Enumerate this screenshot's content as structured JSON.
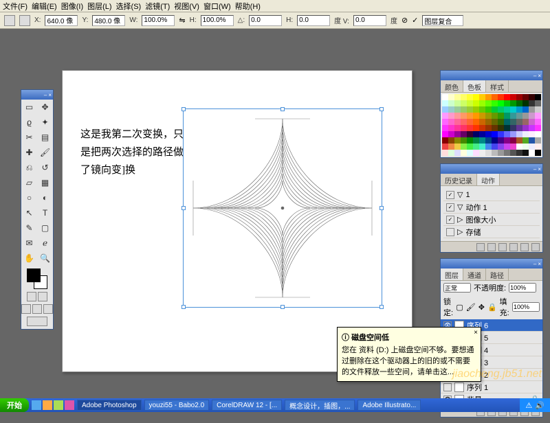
{
  "menu": [
    "文件(F)",
    "编辑(E)",
    "图像(I)",
    "图层(L)",
    "选择(S)",
    "滤镜(T)",
    "视图(V)",
    "窗口(W)",
    "帮助(H)"
  ],
  "optbar": {
    "x_label": "X:",
    "x": "640.0 像",
    "y_label": "Y:",
    "y": "480.0 像",
    "w_label": "W:",
    "w": "100.0%",
    "h_label": "H:",
    "h": "100.0%",
    "delta_label": "△:",
    "delta": "0.0",
    "hskew_label": "H:",
    "hskew": "0.0",
    "vskew_label": "度 V:",
    "vskew": "0.0",
    "deg": "度",
    "mode": "图层复合"
  },
  "doc_text": "这是我第二次变换，只是把两次选择的路径做了镜向变]换",
  "swatch_panel": {
    "tabs": [
      "颜色",
      "色板",
      "样式"
    ]
  },
  "history_panel": {
    "tabs": [
      "历史记录",
      "动作"
    ],
    "items": [
      {
        "chk": "✓",
        "expand": "▽",
        "icon": "■",
        "label": "1"
      },
      {
        "chk": "✓",
        "expand": "▽",
        "icon": "",
        "label": "动作 1"
      },
      {
        "chk": "✓",
        "expand": "▷",
        "icon": "",
        "label": "图像大小"
      },
      {
        "chk": "",
        "expand": "▷",
        "icon": "",
        "label": "存储"
      }
    ]
  },
  "layers_panel": {
    "tabs": [
      "图层",
      "通道",
      "路径"
    ],
    "mode_label": "正常",
    "opacity_label": "不透明度:",
    "opacity": "100%",
    "lock_label": "锁定:",
    "fill_label": "填充:",
    "fill": "100%",
    "layers": [
      {
        "eye": "👁",
        "name": "序列 6",
        "active": true
      },
      {
        "eye": "",
        "name": "序列 5"
      },
      {
        "eye": "",
        "name": "序列 4"
      },
      {
        "eye": "",
        "name": "序列 3"
      },
      {
        "eye": "",
        "name": "序列 2"
      },
      {
        "eye": "",
        "name": "序列 1"
      },
      {
        "eye": "👁",
        "name": "背景",
        "locked": true
      }
    ]
  },
  "balloon": {
    "title": "磁盘空间低",
    "body": "您在 资料 (D:) 上磁盘空间不够。要想通过删除在这个驱动器上的旧的或不需要的文件释放一些空间，请单击这...",
    "close": "×"
  },
  "watermark": "jiaocheng.jb51.net",
  "taskbar": {
    "start": "开始",
    "tasks": [
      "Adobe Photoshop",
      "youzi55 - Babo2.0",
      "CorelDRAW 12 - [...",
      "概念设计，插图，...",
      "Adobe Illustrato..."
    ]
  },
  "swatch_colors": [
    "#fff",
    "#ffc",
    "#ff9",
    "#ff6",
    "#ff3",
    "#ff0",
    "#fc0",
    "#f90",
    "#f60",
    "#f30",
    "#f00",
    "#c00",
    "#900",
    "#600",
    "#300",
    "#000",
    "#cff",
    "#cfc",
    "#cf9",
    "#cf6",
    "#cf3",
    "#cf0",
    "#9f0",
    "#6f0",
    "#3f0",
    "#0f0",
    "#0c0",
    "#090",
    "#060",
    "#030",
    "#333",
    "#666",
    "#9cf",
    "#9cc",
    "#9c9",
    "#9c6",
    "#9c3",
    "#9c0",
    "#6c0",
    "#3c0",
    "#0c3",
    "#0c6",
    "#0c9",
    "#0cc",
    "#09c",
    "#06c",
    "#999",
    "#ccc",
    "#f9f",
    "#f9c",
    "#f99",
    "#f96",
    "#f93",
    "#f90",
    "#c90",
    "#990",
    "#690",
    "#390",
    "#096",
    "#399",
    "#699",
    "#999",
    "#c9c",
    "#f9f",
    "#f6f",
    "#f6c",
    "#f69",
    "#f66",
    "#f63",
    "#f60",
    "#c60",
    "#960",
    "#660",
    "#360",
    "#066",
    "#366",
    "#666",
    "#966",
    "#c6c",
    "#f6f",
    "#f3f",
    "#f3c",
    "#f39",
    "#f36",
    "#f33",
    "#f30",
    "#c30",
    "#930",
    "#630",
    "#330",
    "#033",
    "#336",
    "#639",
    "#93c",
    "#c3f",
    "#f3f",
    "#f0f",
    "#c0c",
    "#909",
    "#606",
    "#303",
    "#006",
    "#009",
    "#00c",
    "#00f",
    "#33f",
    "#66f",
    "#99f",
    "#ccf",
    "#eef",
    "#fef",
    "#fff",
    "#800",
    "#840",
    "#880",
    "#480",
    "#080",
    "#084",
    "#088",
    "#048",
    "#008",
    "#408",
    "#808",
    "#804",
    "#a52",
    "#5a2",
    "#25a",
    "#aaa",
    "#e44",
    "#e84",
    "#ec4",
    "#8e4",
    "#4e4",
    "#4e8",
    "#4ec",
    "#48e",
    "#44e",
    "#84e",
    "#c4e",
    "#e4c",
    "#fefefe",
    "#efe",
    "#eef",
    "#fee",
    "#fdd",
    "#dfd",
    "#ddf",
    "#ffd",
    "#dff",
    "#fdf",
    "#eee",
    "#ddd",
    "#bbb",
    "#999",
    "#777",
    "#555",
    "#333",
    "#111",
    "#fff",
    "#000"
  ]
}
